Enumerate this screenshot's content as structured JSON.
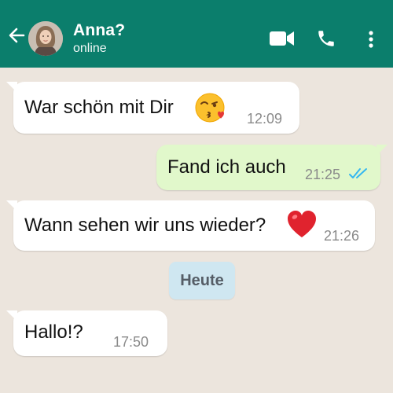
{
  "header": {
    "contact_name": "Anna?",
    "status": "online",
    "back_icon": "arrow-left-icon",
    "video_icon": "video-camera-icon",
    "call_icon": "phone-icon",
    "menu_icon": "more-vertical-icon",
    "color": "#0b7e6c"
  },
  "chat": {
    "background": "#ece5dd",
    "incoming_color": "#ffffff",
    "outgoing_color": "#e1f8cb",
    "messages": [
      {
        "direction": "incoming",
        "text": "War schön mit Dir",
        "emoji": "face-blowing-kiss",
        "time": "12:09"
      },
      {
        "direction": "outgoing",
        "text": "Fand ich auch",
        "time": "21:25",
        "status": "read"
      },
      {
        "direction": "incoming",
        "text": "Wann sehen wir uns wieder?",
        "emoji": "red-heart",
        "time": "21:26"
      },
      {
        "direction": "incoming",
        "text": "Hallo!?",
        "time": "17:50"
      }
    ],
    "date_divider": "Heute"
  }
}
